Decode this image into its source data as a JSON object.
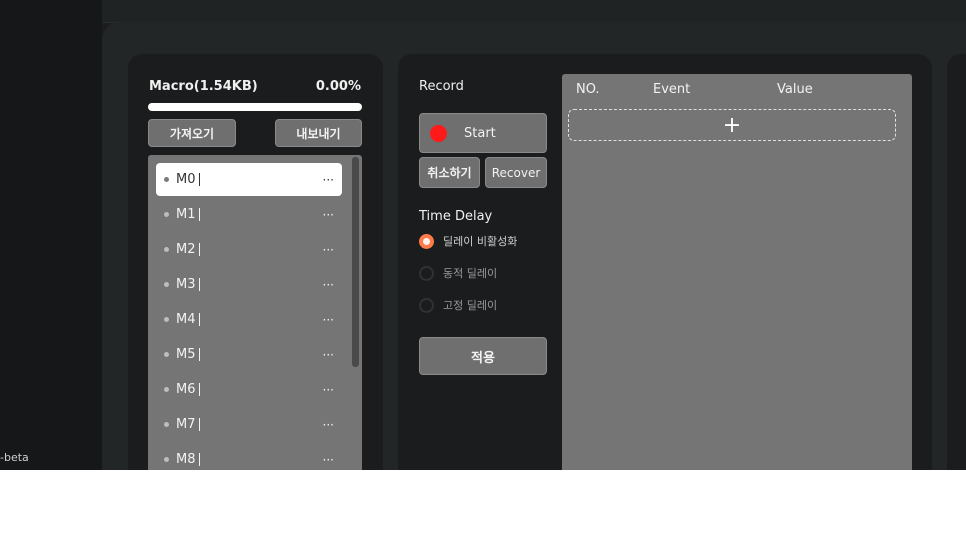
{
  "app": {
    "version_label": "-beta"
  },
  "macro": {
    "title": "Macro(1.54KB)",
    "usage_percent_label": "0.00%",
    "usage_percent": 0,
    "import_label": "가져오기",
    "export_label": "내보내기",
    "items": [
      {
        "label": "M0",
        "more": "···"
      },
      {
        "label": "M1",
        "more": "···"
      },
      {
        "label": "M2",
        "more": "···"
      },
      {
        "label": "M3",
        "more": "···"
      },
      {
        "label": "M4",
        "more": "···"
      },
      {
        "label": "M5",
        "more": "···"
      },
      {
        "label": "M6",
        "more": "···"
      },
      {
        "label": "M7",
        "more": "···"
      },
      {
        "label": "M8",
        "more": "···"
      }
    ],
    "selected_index": 0
  },
  "record": {
    "title": "Record",
    "start_label": "Start",
    "cancel_label": "취소하기",
    "recover_label": "Recover",
    "time_delay_title": "Time Delay",
    "delay_options": [
      "딜레이 비활성화",
      "동적 딜레이",
      "고정 딜레이"
    ],
    "selected_delay_index": 0,
    "apply_label": "적용"
  },
  "events": {
    "columns": [
      "NO.",
      "Event",
      "Value"
    ],
    "add_symbol": "+"
  },
  "colors": {
    "record_dot": "#ff1a1a",
    "radio_selected": "#ff7a4a",
    "panel_bg": "#1a1c1d",
    "list_bg": "#757575"
  }
}
